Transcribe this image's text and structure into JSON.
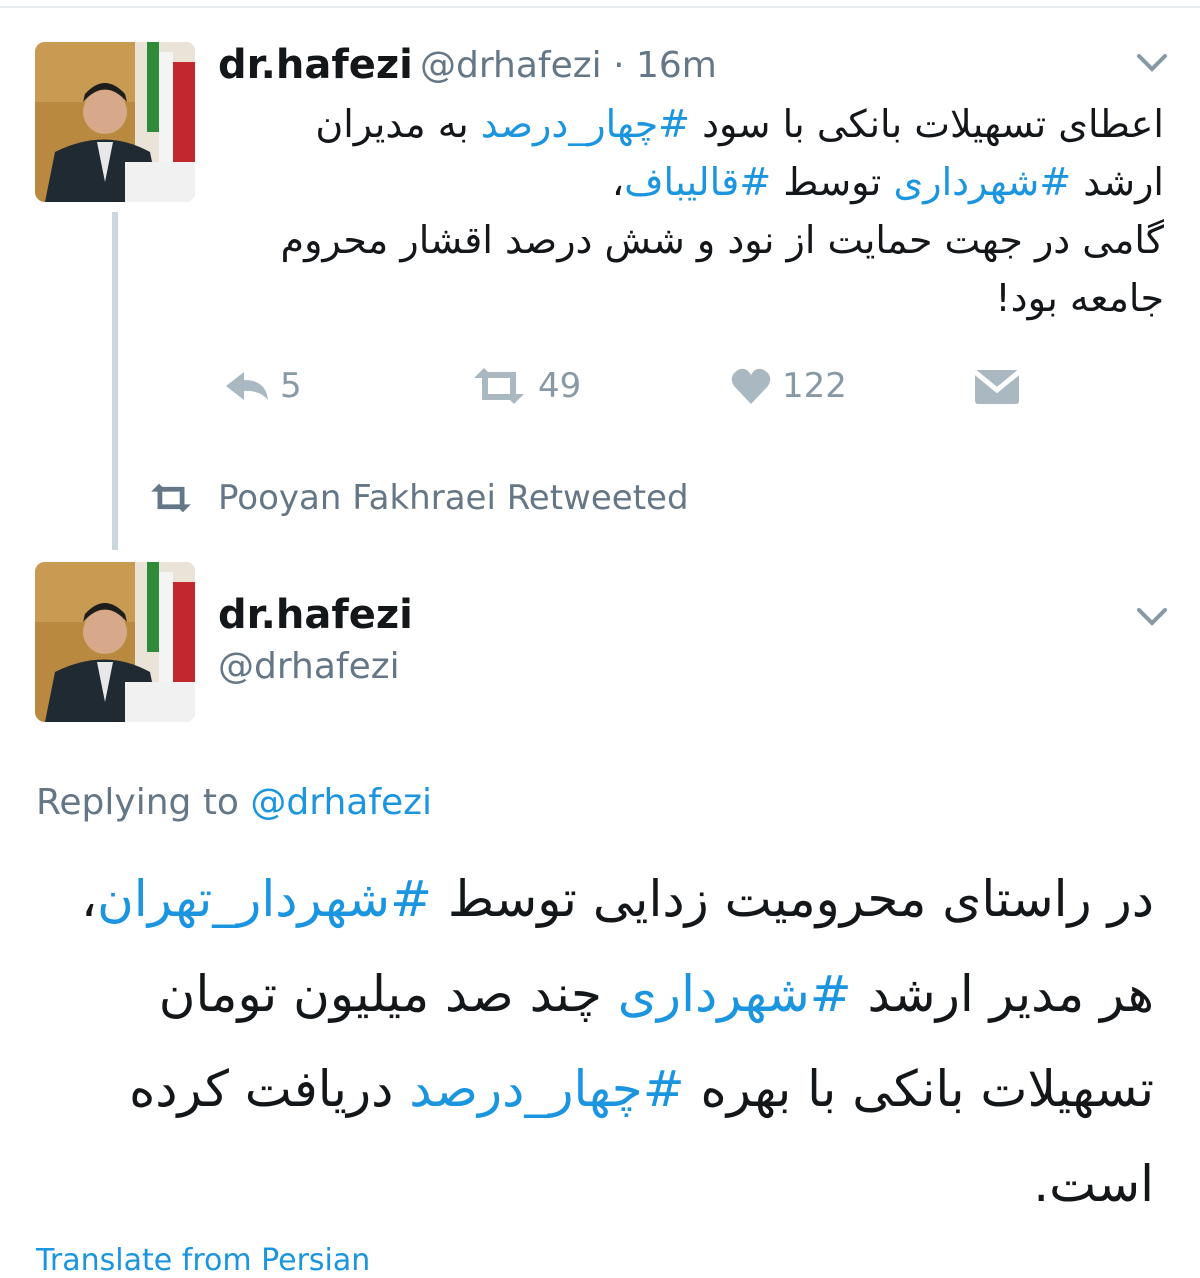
{
  "tweet1": {
    "name": "dr.hafezi",
    "handle": "@drhafezi",
    "separator": "·",
    "time": "16m",
    "lines": [
      [
        {
          "t": "اعطای تسهیلات بانکی با سود "
        },
        {
          "t": "#چهار_درصد",
          "tag": true
        },
        {
          "t": " به مدیران"
        }
      ],
      [
        {
          "t": "ارشد "
        },
        {
          "t": "#شهرداری",
          "tag": true
        },
        {
          "t": " توسط "
        },
        {
          "t": "#قالیباف",
          "tag": true
        },
        {
          "t": "،"
        }
      ],
      [
        {
          "t": "گامی در جهت حمایت از نود و شش درصد اقشار محروم"
        }
      ],
      [
        {
          "t": "جامعه بود!"
        }
      ]
    ],
    "actions": {
      "reply_count": "5",
      "retweet_count": "49",
      "like_count": "122"
    }
  },
  "retweet_notice": {
    "text": "Pooyan Fakhraei Retweeted"
  },
  "tweet2": {
    "name": "dr.hafezi",
    "handle": "@drhafezi",
    "replying_prefix": "Replying to",
    "replying_handle": "@drhafezi",
    "lines": [
      [
        {
          "t": "در راستای محرومیت زدایی توسط "
        },
        {
          "t": "#شهردار_تهران",
          "tag": true
        },
        {
          "t": "،"
        }
      ],
      [
        {
          "t": "هر مدیر ارشد "
        },
        {
          "t": "#شهرداری",
          "tag": true
        },
        {
          "t": " چند صد میلیون تومان"
        }
      ],
      [
        {
          "t": "تسهیلات بانکی با بهره "
        },
        {
          "t": "#چهار_درصد",
          "tag": true
        },
        {
          "t": " دریافت کرده"
        }
      ],
      [
        {
          "t": "است."
        }
      ]
    ],
    "translate_link": "Translate from Persian"
  },
  "colors": {
    "link": "#1b95e0",
    "muted": "#8899a6",
    "text": "#14171a"
  }
}
